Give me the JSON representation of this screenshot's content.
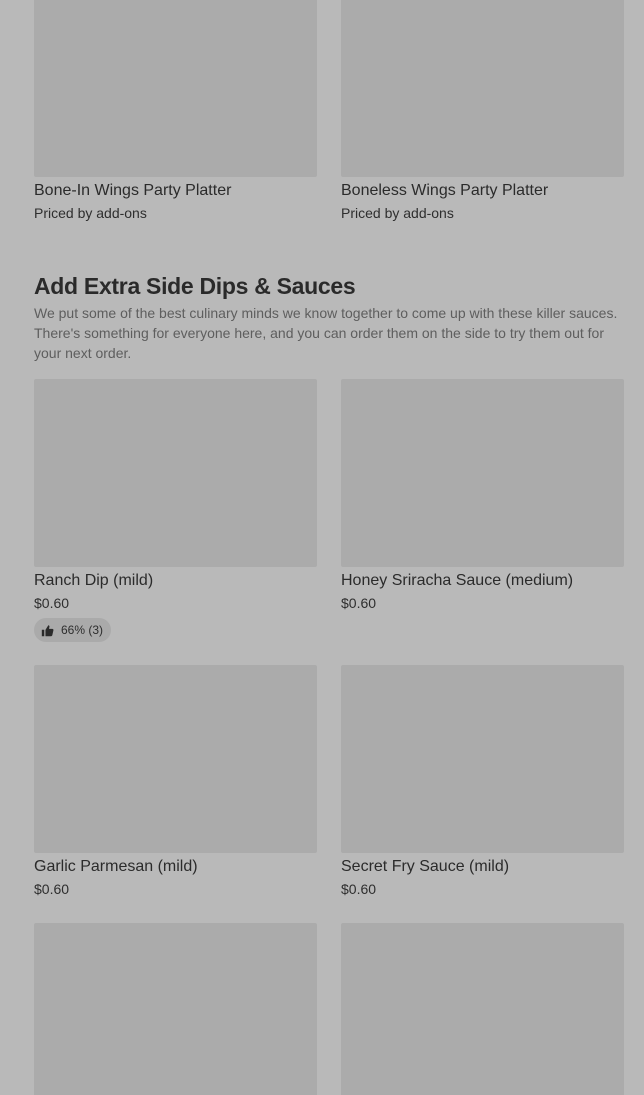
{
  "platters": {
    "items": [
      {
        "name": "Bone-In Wings Party Platter",
        "price": "Priced by add-ons"
      },
      {
        "name": "Boneless Wings Party Platter",
        "price": "Priced by add-ons"
      }
    ]
  },
  "sauces_section": {
    "title": "Add Extra Side Dips & Sauces",
    "description": "We put some of the best culinary minds we know together to come up with these killer sauces. There's something for everyone here, and you can order them on the side to try them out for your next order.",
    "items": [
      {
        "name": "Ranch Dip (mild)",
        "price": "$0.60",
        "rating": "66% (3)",
        "rating_icon": "thumbs-up-icon"
      },
      {
        "name": "Honey Sriracha Sauce (medium)",
        "price": "$0.60"
      },
      {
        "name": "Garlic Parmesan (mild)",
        "price": "$0.60"
      },
      {
        "name": "Secret Fry Sauce (mild)",
        "price": "$0.60"
      }
    ]
  },
  "colors": {
    "background": "#b9b9b9",
    "image_placeholder": "#ababab",
    "text_primary": "#2b2b2b",
    "text_secondary": "#5e5e5e"
  }
}
